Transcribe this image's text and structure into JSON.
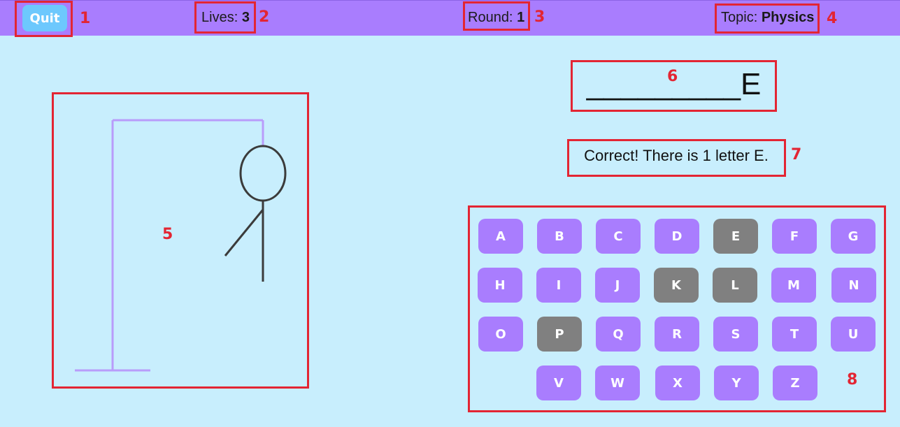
{
  "topbar": {
    "quit_label": "Quit",
    "lives_label": "Lives: ",
    "lives_value": "3",
    "round_label": "Round: ",
    "round_value": "1",
    "topic_label": "Topic: ",
    "topic_value": "Physics"
  },
  "game": {
    "word_display": "_________E",
    "message": "Correct! There is 1 letter E."
  },
  "keyboard": {
    "rows": [
      [
        "A",
        "B",
        "C",
        "D",
        "E",
        "F",
        "G"
      ],
      [
        "H",
        "I",
        "J",
        "K",
        "L",
        "M",
        "N"
      ],
      [
        "O",
        "P",
        "Q",
        "R",
        "S",
        "T",
        "U"
      ],
      [
        "V",
        "W",
        "X",
        "Y",
        "Z"
      ]
    ],
    "used_letters": [
      "E",
      "K",
      "L",
      "P"
    ]
  },
  "annotations": [
    "1",
    "2",
    "3",
    "4",
    "5",
    "6",
    "7",
    "8"
  ],
  "colors": {
    "background": "#c8eefd",
    "accent": "#a97dfe",
    "quit_button": "#6dc8fd",
    "used_key": "#808080",
    "annotation_red": "#e32533"
  }
}
